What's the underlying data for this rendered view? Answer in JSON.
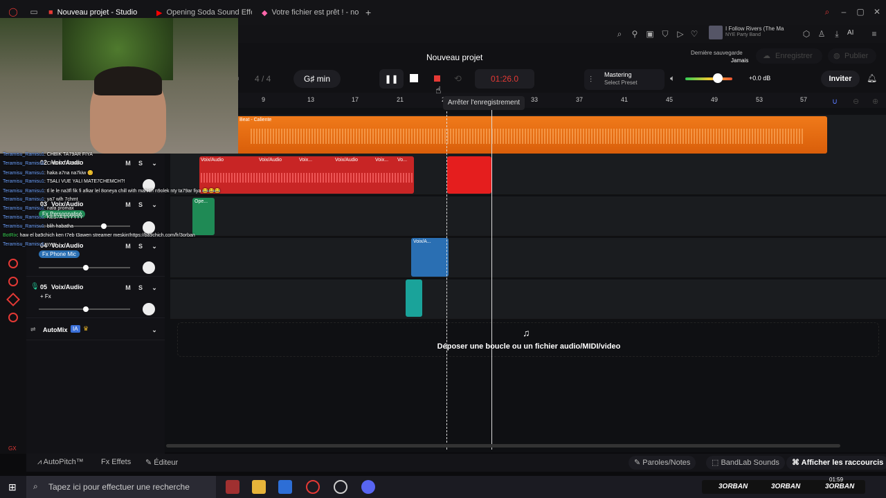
{
  "browser": {
    "tabs": [
      {
        "label": "Nouveau projet - Studio"
      },
      {
        "label": "Opening Soda Sound Effec"
      },
      {
        "label": "Votre fichier est prêt ! - no"
      }
    ],
    "add_tab": "+",
    "media": {
      "title": "I Follow Rivers (The Ma",
      "artist": "NYE Party Band"
    },
    "ai_label": "AI"
  },
  "studio": {
    "project_title": "Nouveau projet",
    "save_status": {
      "label": "Dernière sauvegarde",
      "value": "Jamais"
    },
    "save_button": "Enregistrer",
    "publish_button": "Publier",
    "time_signature": "4 / 4",
    "key": "G♯ min",
    "bpm_partial": "m",
    "time": "01:26.0",
    "mastering": {
      "title": "Mastering",
      "preset": "Select Preset"
    },
    "volume_db": "+0.0 dB",
    "invite": "Inviter",
    "tooltip": "Arrêter l'enregistrement",
    "accent": "#e53935"
  },
  "ruler": [
    "9",
    "13",
    "17",
    "21",
    "25",
    "29",
    "33",
    "37",
    "41",
    "45",
    "49",
    "53",
    "57"
  ],
  "tracks": [
    {
      "num": "02",
      "name": "Voix/Audio",
      "fx": ""
    },
    {
      "num": "03",
      "name": "Voix/Audio",
      "fx": "Fx Personnalisé"
    },
    {
      "num": "04",
      "name": "Voix/Audio",
      "fx": "Fx Phone Mic"
    },
    {
      "num": "05",
      "name": "Voix/Audio",
      "fx": "+ Fx"
    }
  ],
  "mute_label": "M",
  "solo_label": "S",
  "automix": {
    "label": "AutoMix",
    "badge": "IA"
  },
  "clips": {
    "beat": "Beat - Caliente",
    "voice": [
      "Voix/Audio",
      "Voix/Audio",
      "Voix...",
      "Voix/Audio",
      "Voix...",
      "Vo..."
    ],
    "open": "Ope...",
    "voice_a": "Voix/A..."
  },
  "dropzone": "Déposer une boucle ou un fichier audio/MIDI/video",
  "bottom": {
    "autopitch": "AutoPitch™",
    "effects": "Effets",
    "editor": "Éditeur",
    "lyrics": "Paroles/Notes",
    "sounds": "BandLab Sounds",
    "shortcuts": "Afficher les raccourcis"
  },
  "chat": [
    {
      "user": "Teramisu_Ramisu1",
      "msg": ": CHBIK TA79AR FIYA"
    },
    {
      "user": "Teramisu_Ramisu1",
      "msg": ": CHBIK TA79AR"
    },
    {
      "user": "Teramisu_Ramisu1",
      "msg": ": haka a7na na7kiw 😊"
    },
    {
      "user": "Teramisu_Ramisu1",
      "msg": ": T5ALI VUE YALI MATE7CHEMCH?!"
    },
    {
      "user": "Teramisu_Ramisu1",
      "msg": ": tl le le na3fl fik fi afkar lel 8oneya chill with mahich n9olek nty ta79ar fiya 😂😂😂"
    },
    {
      "user": "Teramisu_Ramisu1",
      "msg": ": ya7 wlh 7chmt"
    },
    {
      "user": "Teramisu_Ramisu1",
      "msg": ": nafa promax"
    },
    {
      "user": "Teramisu_Ramisu1",
      "msg": ": KES7A EYYYYY"
    },
    {
      "user": "Teramisu_Ramisu1",
      "msg": ": blih habatha"
    },
    {
      "user": "BotRix",
      "msg": ": haw el ba9chich ken t7eb t3awen streamer meskin!https://ba9chich.com/fr/3orban"
    },
    {
      "user": "Teramisu_Ramisu1",
      "msg": ": yyyy"
    }
  ],
  "taskbar": {
    "search_placeholder": "Tapez ici pour effectuer une recherche",
    "time": "01:59",
    "social": "3ORBAN"
  },
  "rail": {
    "gx": "GX"
  }
}
